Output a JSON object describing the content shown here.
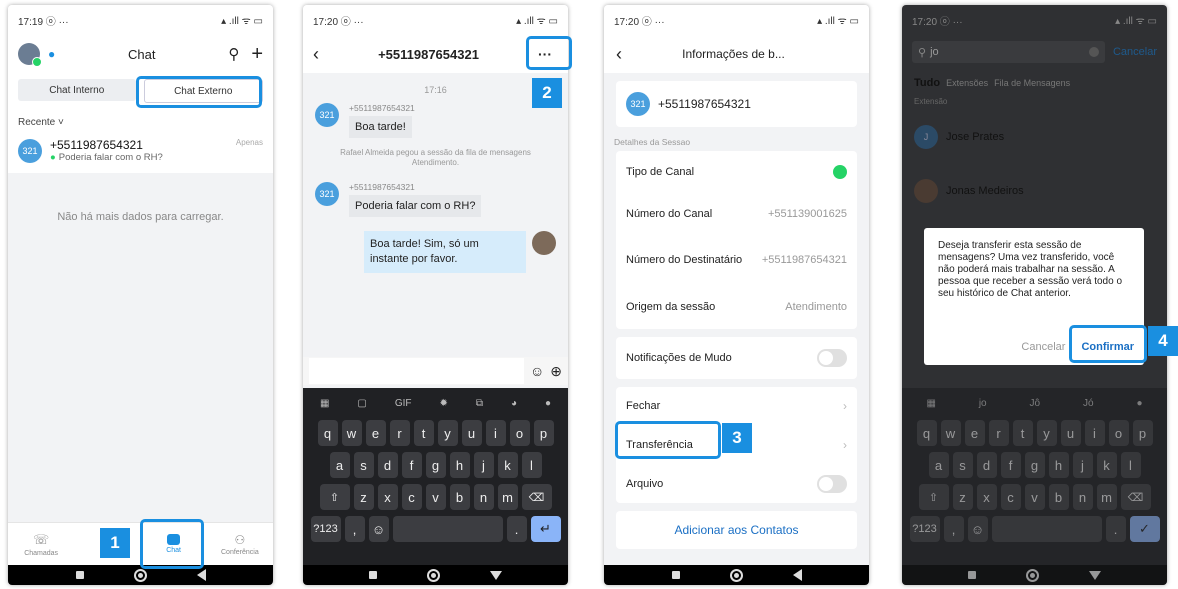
{
  "colors": {
    "accent": "#1a8fe0",
    "whatsapp": "#25d366",
    "avatar": "#4a9fdd"
  },
  "steps": [
    "1",
    "2",
    "3",
    "4"
  ],
  "phone1": {
    "time": "17:19 ⓞ ···",
    "title": "Chat",
    "seg": {
      "internal": "Chat Interno",
      "external": "Chat Externo"
    },
    "recent": "Recente ˅",
    "conversation": {
      "avatar": "321",
      "name": "+5511987654321",
      "tag": "Apenas",
      "preview": "Poderia falar com o RH?"
    },
    "empty": "Não há mais dados para carregar.",
    "tabs": [
      {
        "label": "Chamadas"
      },
      {
        "label": "C"
      },
      {
        "label": "Chat"
      },
      {
        "label": "Conferência"
      }
    ]
  },
  "phone2": {
    "time": "17:20 ⓞ ···",
    "title": "+5511987654321",
    "chat_time": "17:16",
    "messages": [
      {
        "avatar": "321",
        "who": "+5511987654321",
        "text": "Boa tarde!"
      },
      {
        "avatar": "321",
        "who": "+5511987654321",
        "text": "Poderia falar com o RH?"
      }
    ],
    "system": "Rafael Almeida pegou a sessão da fila de mensagens Atendimento.",
    "mine": "Boa tarde! Sim, só um instante por favor."
  },
  "keyboard": {
    "row1": [
      "q",
      "w",
      "e",
      "r",
      "t",
      "y",
      "u",
      "i",
      "o",
      "p"
    ],
    "row2": [
      "a",
      "s",
      "d",
      "f",
      "g",
      "h",
      "j",
      "k",
      "l"
    ],
    "row3": [
      "z",
      "x",
      "c",
      "v",
      "b",
      "n",
      "m"
    ],
    "k123": "?123",
    "comma": ",",
    "period": ".",
    "gif": "GIF",
    "suggestions": [
      "jo",
      "Jô",
      "Jó"
    ]
  },
  "phone3": {
    "time": "17:20 ⓞ ···",
    "title": "Informações de b...",
    "contact": {
      "avatar": "321",
      "number": "+5511987654321"
    },
    "section": "Detalhes da Sessao",
    "rows": [
      {
        "label": "Tipo de Canal",
        "value": ""
      },
      {
        "label": "Número do Canal",
        "value": "+551139001625"
      },
      {
        "label": "Número do Destinatário",
        "value": "+5511987654321"
      },
      {
        "label": "Origem da sessão",
        "value": "Atendimento"
      }
    ],
    "mute": "Notificações de Mudo",
    "close": "Fechar",
    "transfer": "Transferência",
    "archive": "Arquivo",
    "add": "Adicionar aos Contatos"
  },
  "phone4": {
    "time": "17:20 ⓞ ···",
    "query": "jo",
    "cancel": "Cancelar",
    "tabs": {
      "all": "Tudo",
      "ext": "Extensões",
      "queue": "Fila de Mensagens"
    },
    "section": "Extensão",
    "people": [
      {
        "initial": "J",
        "name": "Jose Prates"
      },
      {
        "initial": "",
        "name": "Jonas Medeiros"
      }
    ],
    "dialog": {
      "text": "Deseja transferir esta sessão de mensagens? Uma vez transferido, você não poderá mais trabalhar na sessão. A pessoa que receber a sessão verá todo o seu histórico de Chat anterior.",
      "cancel": "Cancelar",
      "confirm": "Confirmar"
    }
  }
}
